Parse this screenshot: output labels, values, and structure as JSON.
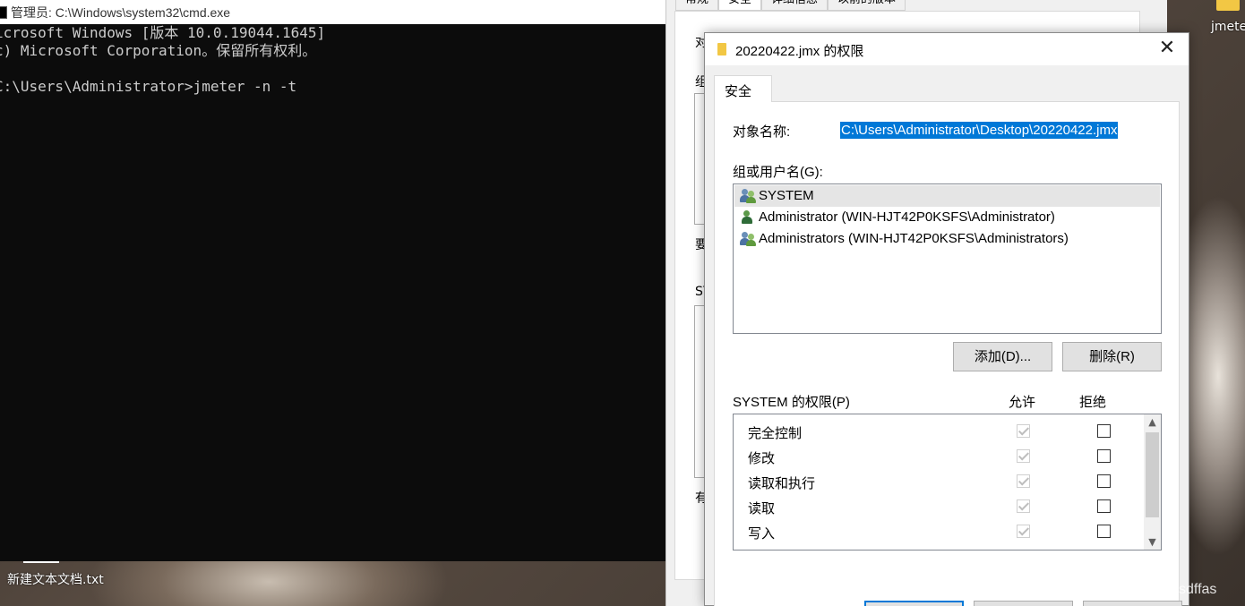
{
  "desktop": {
    "top_right_icon_label": "jmete",
    "bottom_icon_label": "新建文本文档.txt",
    "watermark": "CSDN @sdffas"
  },
  "cmd": {
    "title": "管理员: C:\\Windows\\system32\\cmd.exe",
    "lines": [
      "icrosoft Windows [版本 10.0.19044.1645]",
      "c) Microsoft Corporation。保留所有权利。",
      "",
      "C:\\Users\\Administrator>jmeter -n -t"
    ]
  },
  "properties": {
    "tabs": [
      "常规",
      "安全",
      "详细信息",
      "以前的版本"
    ],
    "fragments": [
      "对",
      "组",
      "要",
      "SY",
      "有"
    ]
  },
  "dialog": {
    "title": "20220422.jmx 的权限",
    "tab": "安全",
    "object_name_label": "对象名称:",
    "object_name_value": "C:\\Users\\Administrator\\Desktop\\20220422.jmx",
    "group_label": "组或用户名(G):",
    "users": [
      {
        "name": "SYSTEM",
        "icon": "group-users-icon",
        "selected": true
      },
      {
        "name": "Administrator (WIN-HJT42P0KSFS\\Administrator)",
        "icon": "user-icon",
        "selected": false
      },
      {
        "name": "Administrators (WIN-HJT42P0KSFS\\Administrators)",
        "icon": "group-users-icon",
        "selected": false
      }
    ],
    "add_button": "添加(D)...",
    "remove_button": "删除(R)",
    "permissions_label": "SYSTEM 的权限(P)",
    "allow_header": "允许",
    "deny_header": "拒绝",
    "permissions": [
      {
        "name": "完全控制",
        "allow": true,
        "deny": false
      },
      {
        "name": "修改",
        "allow": true,
        "deny": false
      },
      {
        "name": "读取和执行",
        "allow": true,
        "deny": false
      },
      {
        "name": "读取",
        "allow": true,
        "deny": false
      },
      {
        "name": "写入",
        "allow": true,
        "deny": false
      }
    ]
  }
}
